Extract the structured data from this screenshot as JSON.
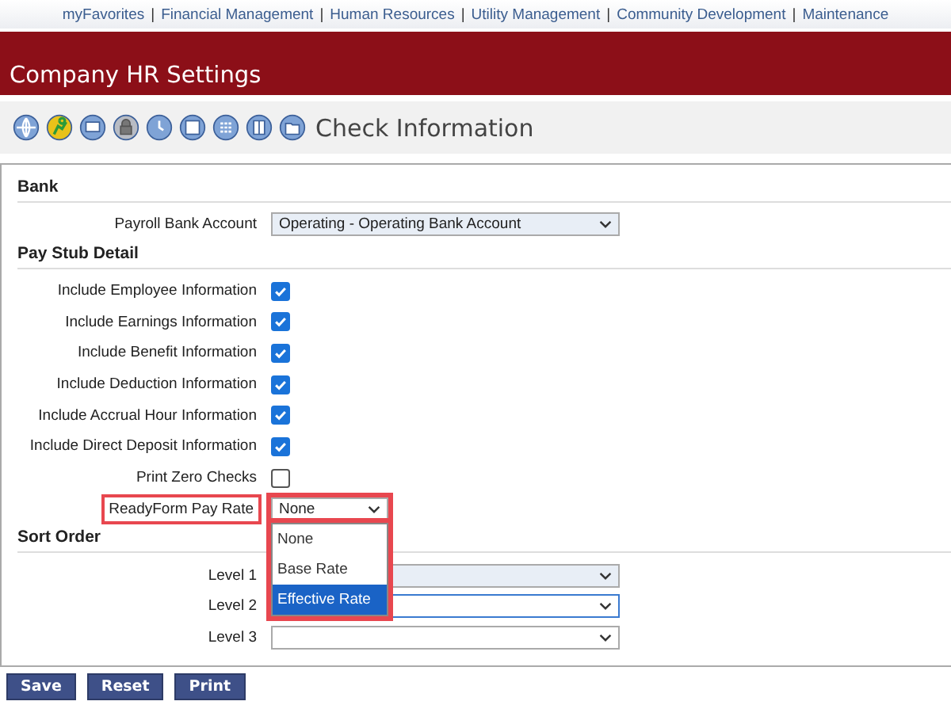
{
  "nav_separator": "|",
  "nav": [
    "myFavorites",
    "Financial Management",
    "Human Resources",
    "Utility Management",
    "Community Development",
    "Maintenance"
  ],
  "header": {
    "title": "Company HR Settings"
  },
  "toolbar": {
    "title": "Check Information"
  },
  "sections": [
    {
      "title": "Bank",
      "fields": [
        {
          "kind": "select",
          "label": "Payroll Bank Account",
          "value": "Operating - Operating Bank Account",
          "filled": true
        }
      ]
    },
    {
      "title": "Pay Stub Detail",
      "fields": [
        {
          "kind": "checkbox",
          "label": "Include Employee Information",
          "checked": true
        },
        {
          "kind": "checkbox",
          "label": "Include Earnings Information",
          "checked": true
        },
        {
          "kind": "checkbox",
          "label": "Include Benefit Information",
          "checked": true
        },
        {
          "kind": "checkbox",
          "label": "Include Deduction Information",
          "checked": true
        },
        {
          "kind": "checkbox",
          "label": "Include Accrual Hour Information",
          "checked": true
        },
        {
          "kind": "checkbox",
          "label": "Include Direct Deposit Information",
          "checked": true
        },
        {
          "kind": "checkbox",
          "label": "Print Zero Checks",
          "checked": false
        },
        {
          "kind": "select",
          "label": "ReadyForm Pay Rate",
          "value": "None",
          "highlighted": true,
          "expanded": true,
          "options": [
            {
              "label": "None",
              "highlighted": false
            },
            {
              "label": "Base Rate",
              "highlighted": false
            },
            {
              "label": "Effective Rate",
              "highlighted": true
            }
          ]
        }
      ]
    },
    {
      "title": "Sort Order",
      "fields": [
        {
          "kind": "select",
          "label": "Level 1",
          "filled": true
        },
        {
          "kind": "select",
          "label": "Level 2",
          "focused": true
        },
        {
          "kind": "select",
          "label": "Level 3"
        }
      ]
    }
  ],
  "buttons": [
    "Save",
    "Reset",
    "Print"
  ]
}
